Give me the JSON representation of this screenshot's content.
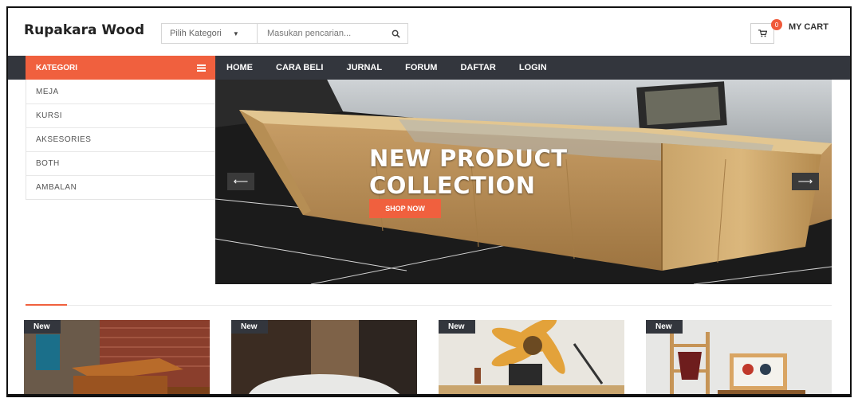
{
  "header": {
    "logo": "Rupakara Wood",
    "search": {
      "category_label": "Pilih Kategori",
      "placeholder": "Masukan pencarian...",
      "search_icon": "search-icon"
    },
    "cart": {
      "count": "0",
      "label": "MY CART",
      "icon": "cart-icon"
    }
  },
  "nav": {
    "items": [
      "HOME",
      "CARA BELI",
      "JURNAL",
      "FORUM",
      "DAFTAR",
      "LOGIN"
    ]
  },
  "kategori": {
    "title": "KATEGORI",
    "menu_icon": "hamburger-icon",
    "items": [
      "MEJA",
      "KURSI",
      "AKSESORIES",
      "BOTH",
      "AMBALAN"
    ]
  },
  "hero": {
    "title_line1": "NEW PRODUCT",
    "title_line2": "COLLECTION",
    "button": "SHOP NOW",
    "prev_icon": "arrow-left-icon",
    "next_icon": "arrow-right-icon"
  },
  "products": [
    {
      "badge": "New"
    },
    {
      "badge": "New"
    },
    {
      "badge": "New"
    },
    {
      "badge": "New"
    }
  ],
  "colors": {
    "accent": "#f0603e",
    "nav_bg": "#33363d"
  }
}
